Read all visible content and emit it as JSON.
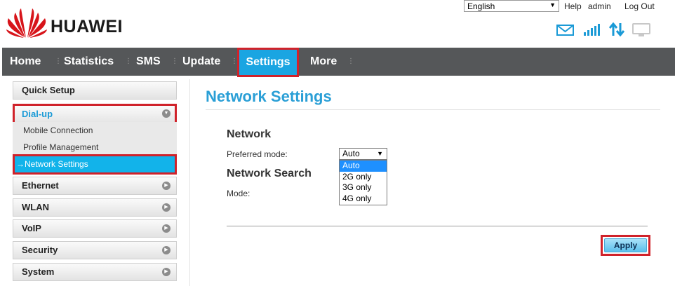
{
  "header": {
    "brand": "HUAWEI",
    "language": "English",
    "links": {
      "help": "Help",
      "user": "admin",
      "logout": "Log Out"
    },
    "status_icons": [
      "mail-icon",
      "signal-icon",
      "data-transfer-icon",
      "pc-connection-icon"
    ]
  },
  "nav": {
    "items": [
      "Home",
      "Statistics",
      "SMS",
      "Update",
      "Settings",
      "More"
    ],
    "active": "Settings"
  },
  "sidebar": {
    "quick_setup": "Quick Setup",
    "dialup": "Dial-up",
    "dialup_children": [
      "Mobile Connection",
      "Profile Management"
    ],
    "active_child": "Network Settings",
    "active_prefix": "→",
    "sections": [
      "Ethernet",
      "WLAN",
      "VoIP",
      "Security",
      "System"
    ]
  },
  "content": {
    "title": "Network Settings",
    "network": {
      "heading": "Network",
      "preferred_mode_label": "Preferred mode:",
      "preferred_mode_value": "Auto",
      "options": [
        "Auto",
        "2G only",
        "3G only",
        "4G only"
      ]
    },
    "network_search": {
      "heading": "Network Search",
      "mode_label": "Mode:"
    },
    "apply": "Apply"
  },
  "colors": {
    "nav_bg": "#555759",
    "accent": "#1aa5e2",
    "highlight": "#d0222a",
    "title": "#2a9fd6"
  }
}
